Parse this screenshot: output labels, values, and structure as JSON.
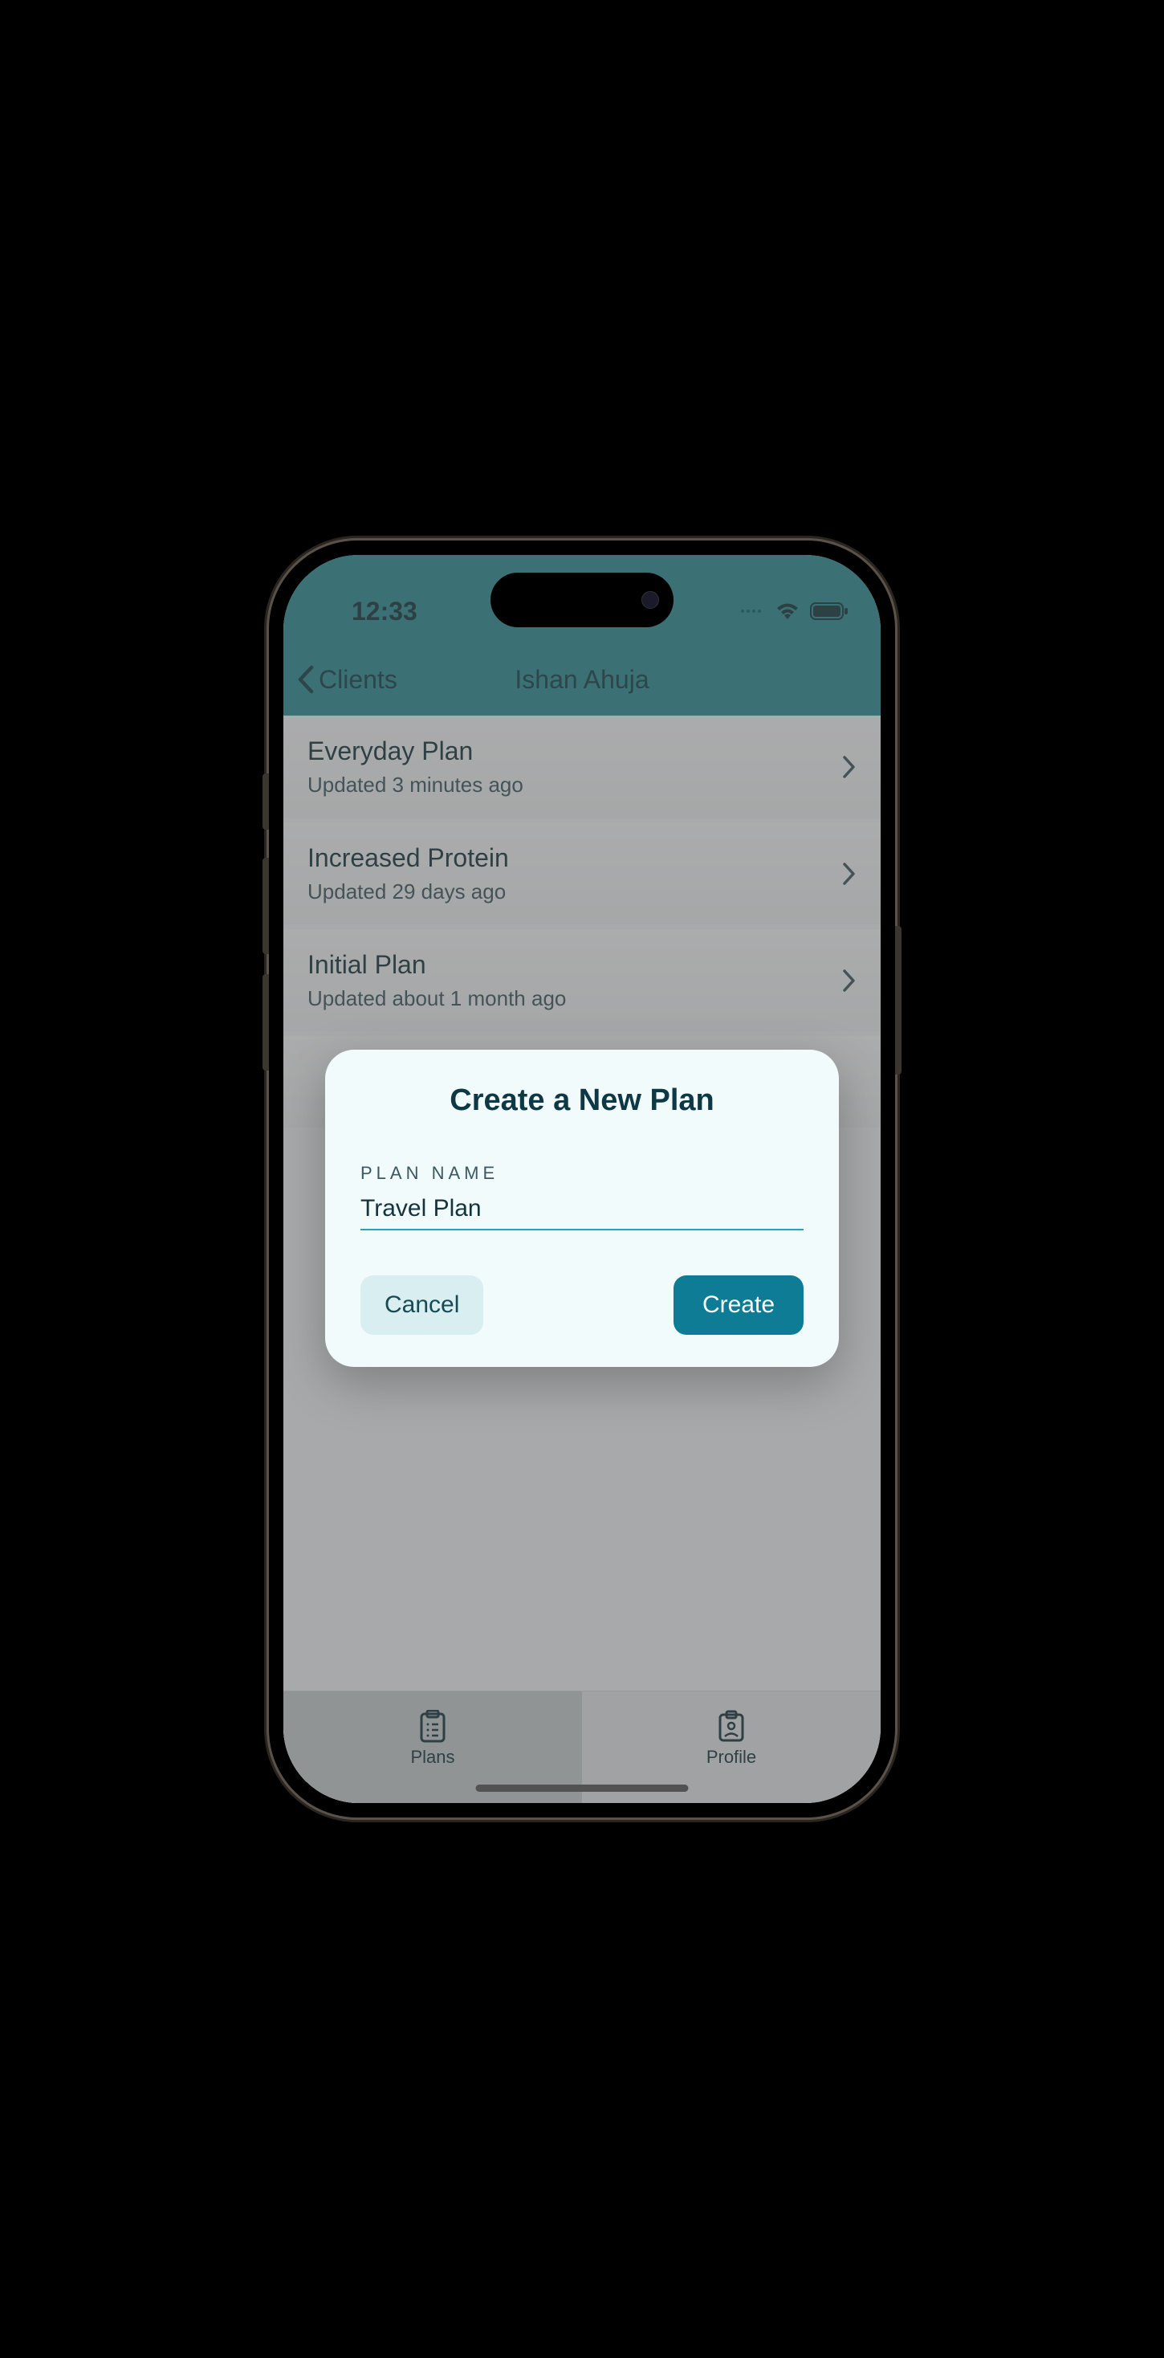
{
  "status": {
    "time": "12:33"
  },
  "header": {
    "back_label": "Clients",
    "title": "Ishan Ahuja"
  },
  "plans": [
    {
      "title": "Everyday Plan",
      "subtitle": "Updated 3 minutes ago"
    },
    {
      "title": "Increased Protein",
      "subtitle": "Updated 29 days ago"
    },
    {
      "title": "Initial Plan",
      "subtitle": "Updated about 1 month ago"
    }
  ],
  "modal": {
    "title": "Create a New Plan",
    "field_label": "PLAN NAME",
    "field_value": "Travel Plan",
    "cancel_label": "Cancel",
    "create_label": "Create"
  },
  "tabs": {
    "plans": "Plans",
    "profile": "Profile"
  }
}
